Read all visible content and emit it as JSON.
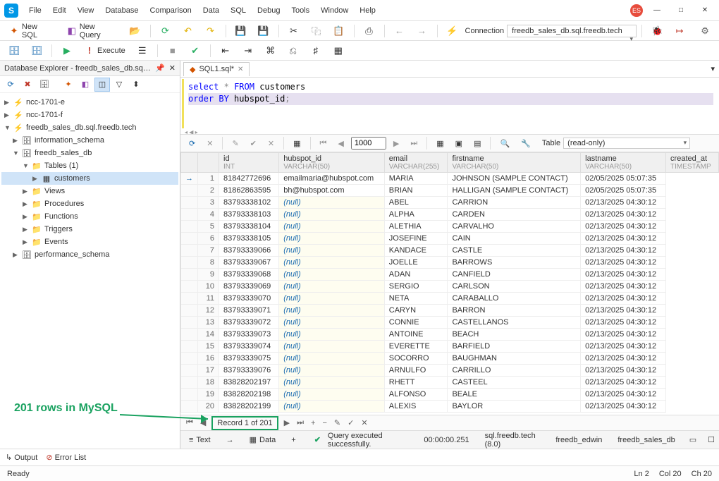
{
  "menu": [
    "File",
    "Edit",
    "View",
    "Database",
    "Comparison",
    "Data",
    "SQL",
    "Debug",
    "Tools",
    "Window",
    "Help"
  ],
  "user_badge": "ES",
  "toolbar1": {
    "new_sql": "New SQL",
    "new_query": "New Query",
    "connection_label": "Connection",
    "connection_value": "freedb_sales_db.sql.freedb.tech"
  },
  "toolbar2": {
    "execute": "Execute"
  },
  "sidebar": {
    "title": "Database Explorer - freedb_sales_db.sql.f…",
    "tree": {
      "ncc1": "ncc-1701-e",
      "ncc2": "ncc-1701-f",
      "conn": "freedb_sales_db.sql.freedb.tech",
      "info": "information_schema",
      "db": "freedb_sales_db",
      "tables": "Tables (1)",
      "customers": "customers",
      "views": "Views",
      "procedures": "Procedures",
      "functions": "Functions",
      "triggers": "Triggers",
      "events": "Events",
      "perf": "performance_schema"
    }
  },
  "editor_tab": "SQL1.sql*",
  "sql": {
    "l1a": "select",
    "l1b": "*",
    "l1c": "FROM",
    "l1d": "customers",
    "l2a": "order",
    "l2b": "BY",
    "l2c": "hubspot_id",
    "l2d": ";"
  },
  "grid": {
    "page_size": "1000",
    "table_label": "Table",
    "table_mode": "(read-only)",
    "columns": [
      {
        "name": "id",
        "type": "INT"
      },
      {
        "name": "hubspot_id",
        "type": "VARCHAR(50)"
      },
      {
        "name": "email",
        "type": "VARCHAR(255)"
      },
      {
        "name": "firstname",
        "type": "VARCHAR(50)"
      },
      {
        "name": "lastname",
        "type": "VARCHAR(50)"
      },
      {
        "name": "created_at",
        "type": "TIMESTAMP"
      }
    ],
    "rows": [
      {
        "n": 1,
        "hub": "81842772696",
        "email": "emailmaria@hubspot.com",
        "fn": "MARIA",
        "ln": "JOHNSON (SAMPLE CONTACT)",
        "ts": "02/05/2025 05:07:35"
      },
      {
        "n": 2,
        "hub": "81862863595",
        "email": "bh@hubspot.com",
        "fn": "BRIAN",
        "ln": "HALLIGAN (SAMPLE CONTACT)",
        "ts": "02/05/2025 05:07:35"
      },
      {
        "n": 3,
        "hub": "83793338102",
        "email": null,
        "fn": "ABEL",
        "ln": "CARRION",
        "ts": "02/13/2025 04:30:12"
      },
      {
        "n": 4,
        "hub": "83793338103",
        "email": null,
        "fn": "ALPHA",
        "ln": "CARDEN",
        "ts": "02/13/2025 04:30:12"
      },
      {
        "n": 5,
        "hub": "83793338104",
        "email": null,
        "fn": "ALETHIA",
        "ln": "CARVALHO",
        "ts": "02/13/2025 04:30:12"
      },
      {
        "n": 6,
        "hub": "83793338105",
        "email": null,
        "fn": "JOSEFINE",
        "ln": "CAIN",
        "ts": "02/13/2025 04:30:12"
      },
      {
        "n": 7,
        "hub": "83793339066",
        "email": null,
        "fn": "KANDACE",
        "ln": "CASTLE",
        "ts": "02/13/2025 04:30:12"
      },
      {
        "n": 8,
        "hub": "83793339067",
        "email": null,
        "fn": "JOELLE",
        "ln": "BARROWS",
        "ts": "02/13/2025 04:30:12"
      },
      {
        "n": 9,
        "hub": "83793339068",
        "email": null,
        "fn": "ADAN",
        "ln": "CANFIELD",
        "ts": "02/13/2025 04:30:12"
      },
      {
        "n": 10,
        "hub": "83793339069",
        "email": null,
        "fn": "SERGIO",
        "ln": "CARLSON",
        "ts": "02/13/2025 04:30:12"
      },
      {
        "n": 11,
        "hub": "83793339070",
        "email": null,
        "fn": "NETA",
        "ln": "CARABALLO",
        "ts": "02/13/2025 04:30:12"
      },
      {
        "n": 12,
        "hub": "83793339071",
        "email": null,
        "fn": "CARYN",
        "ln": "BARRON",
        "ts": "02/13/2025 04:30:12"
      },
      {
        "n": 13,
        "hub": "83793339072",
        "email": null,
        "fn": "CONNIE",
        "ln": "CASTELLANOS",
        "ts": "02/13/2025 04:30:12"
      },
      {
        "n": 14,
        "hub": "83793339073",
        "email": null,
        "fn": "ANTOINE",
        "ln": "BEACH",
        "ts": "02/13/2025 04:30:12"
      },
      {
        "n": 15,
        "hub": "83793339074",
        "email": null,
        "fn": "EVERETTE",
        "ln": "BARFIELD",
        "ts": "02/13/2025 04:30:12"
      },
      {
        "n": 16,
        "hub": "83793339075",
        "email": null,
        "fn": "SOCORRO",
        "ln": "BAUGHMAN",
        "ts": "02/13/2025 04:30:12"
      },
      {
        "n": 17,
        "hub": "83793339076",
        "email": null,
        "fn": "ARNULFO",
        "ln": "CARRILLO",
        "ts": "02/13/2025 04:30:12"
      },
      {
        "n": 18,
        "hub": "83828202197",
        "email": null,
        "fn": "RHETT",
        "ln": "CASTEEL",
        "ts": "02/13/2025 04:30:12"
      },
      {
        "n": 19,
        "hub": "83828202198",
        "email": null,
        "fn": "ALFONSO",
        "ln": "BEALE",
        "ts": "02/13/2025 04:30:12"
      },
      {
        "n": 20,
        "hub": "83828202199",
        "email": null,
        "fn": "ALEXIS",
        "ln": "BAYLOR",
        "ts": "02/13/2025 04:30:12"
      }
    ],
    "record_label": "Record 1 of 201"
  },
  "bottom": {
    "text_tab": "Text",
    "data_tab": "Data",
    "status_msg": "Query executed successfully.",
    "elapsed": "00:00:00.251",
    "server": "sql.freedb.tech (8.0)",
    "user": "freedb_edwin",
    "db": "freedb_sales_db"
  },
  "footer": {
    "output": "Output",
    "errors": "Error List"
  },
  "status": {
    "ready": "Ready",
    "ln": "Ln 2",
    "col": "Col 20",
    "ch": "Ch 20"
  },
  "annotation": "201 rows in MySQL"
}
